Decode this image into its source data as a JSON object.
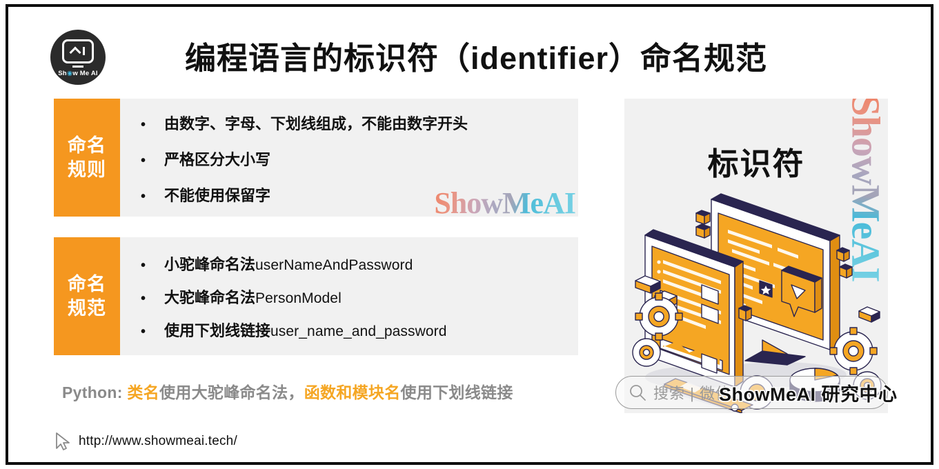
{
  "slide": {
    "title": "编程语言的标识符（identifier）命名规范",
    "logo": {
      "name": "showmeai-logo",
      "text_before_dot": "Sh",
      "dot": "◉",
      "text_after_dot": "w Me AI"
    }
  },
  "blocks": [
    {
      "tag_line1": "命名",
      "tag_line2": "规则",
      "bullet": "•",
      "items": [
        {
          "zh": "由数字、字母、下划线组成，不能由数字开头",
          "code": ""
        },
        {
          "zh": "严格区分大小写",
          "code": ""
        },
        {
          "zh": "不能使用保留字",
          "code": ""
        }
      ]
    },
    {
      "tag_line1": "命名",
      "tag_line2": "规范",
      "bullet": "•",
      "items": [
        {
          "zh": "小驼峰命名法 ",
          "code": "userNameAndPassword"
        },
        {
          "zh": "大驼峰命名法 ",
          "code": "PersonModel"
        },
        {
          "zh": "使用下划线链接 ",
          "code": "user_name_and_password"
        }
      ]
    }
  ],
  "python_note": {
    "prefix": "Python: ",
    "hl1": "类名",
    "mid1": "使用大驼峰命名法，",
    "hl2": "函数和模块名",
    "mid2": "使用下划线链接"
  },
  "footer": {
    "url": "http://www.showmeai.tech/",
    "cursor_icon": "cursor-arrow-icon"
  },
  "right_panel": {
    "heading": "标识符",
    "watermark": "ShowMeAI",
    "illustration_alt": "isometric-devices-gears-illustration"
  },
  "left_watermark": "ShowMeAI",
  "search_bar": {
    "placeholder": "搜索 | 微信",
    "icon": "magnifier-icon",
    "overlay_text": "ShowMeAI 研究中心"
  },
  "colors": {
    "accent_orange": "#F5971F",
    "panel_gray": "#F1F1F1",
    "note_gray": "#8A8A8A",
    "highlight_orange": "#F5A623",
    "logo_dark": "#2B2B2B"
  }
}
